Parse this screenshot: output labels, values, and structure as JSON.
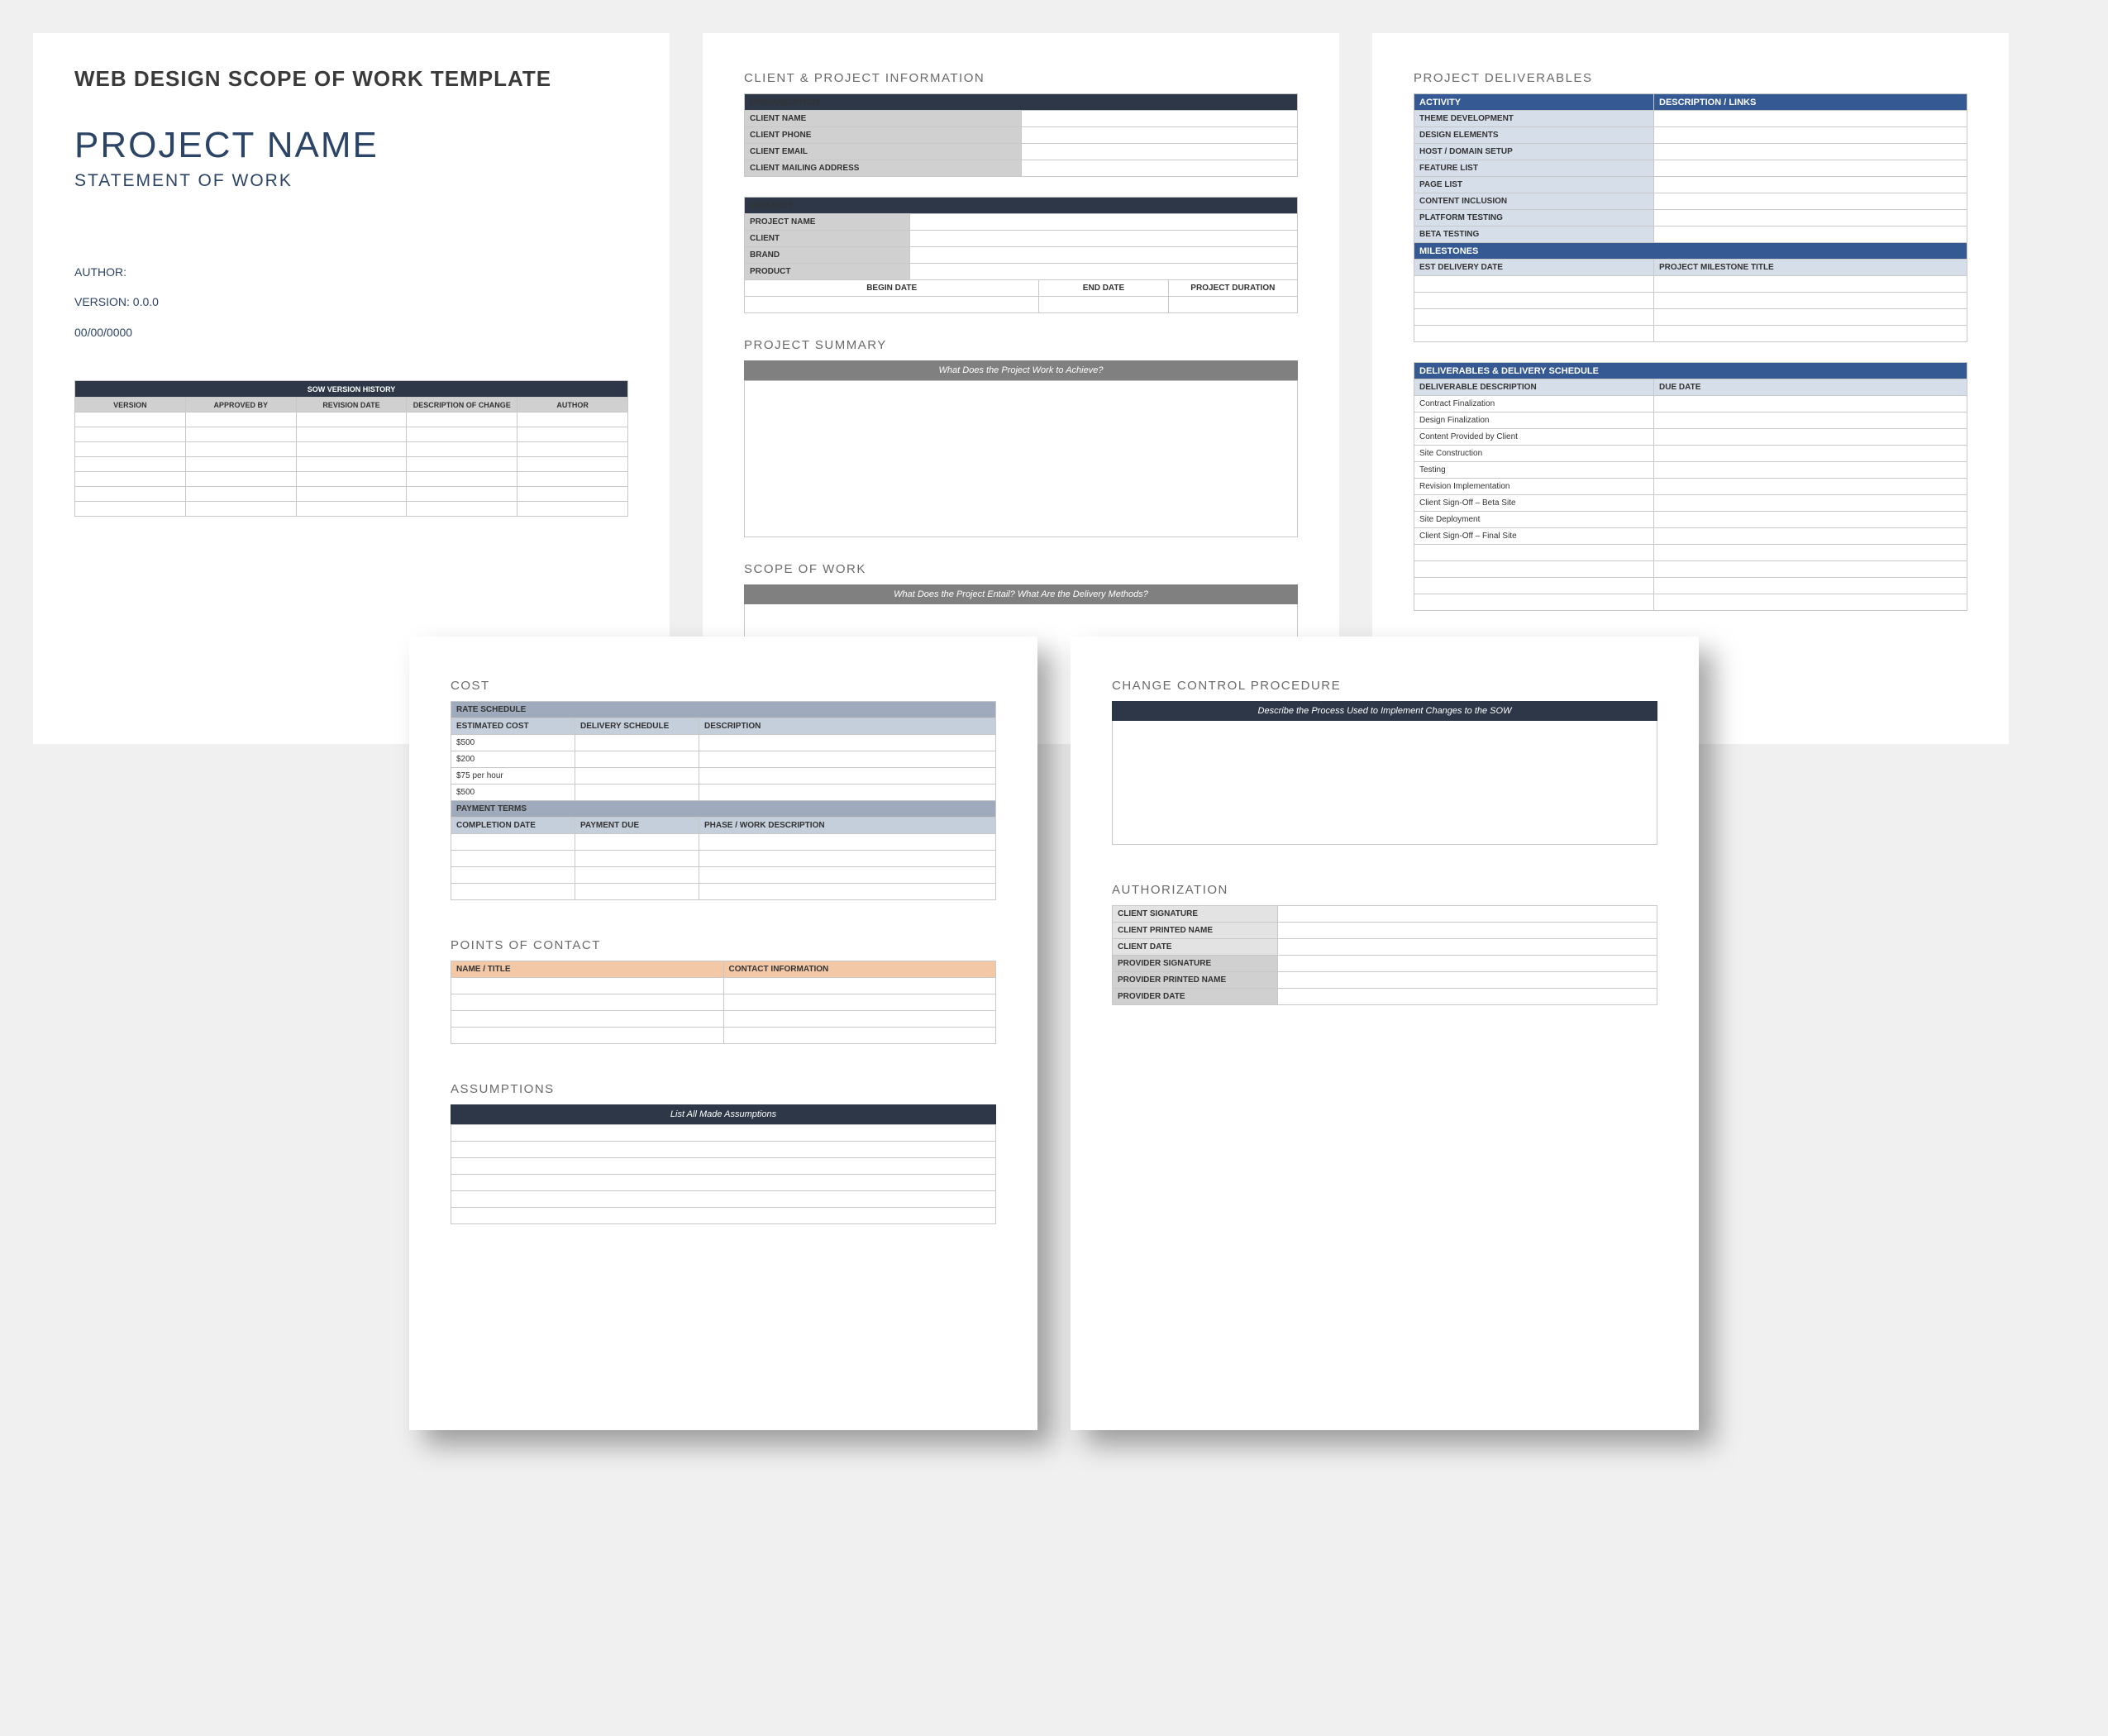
{
  "page1": {
    "template_title": "WEB DESIGN SCOPE OF WORK TEMPLATE",
    "project_name": "PROJECT NAME",
    "subtitle": "STATEMENT OF WORK",
    "author_label": "AUTHOR:",
    "version_label": "VERSION: 0.0.0",
    "date": "00/00/0000",
    "history": {
      "title": "SOW VERSION HISTORY",
      "cols": [
        "VERSION",
        "APPROVED BY",
        "REVISION DATE",
        "DESCRIPTION OF CHANGE",
        "AUTHOR"
      ]
    }
  },
  "page2": {
    "client_project_info": "CLIENT & PROJECT INFORMATION",
    "organization_hdr": "ORGANIZATION",
    "org_rows": [
      "CLIENT NAME",
      "CLIENT  PHONE",
      "CLIENT EMAIL",
      "CLIENT MAILING ADDRESS"
    ],
    "project_hdr": "PROJECT",
    "proj_rows": [
      "PROJECT NAME",
      "CLIENT",
      "BRAND",
      "PRODUCT"
    ],
    "proj_dates": [
      "BEGIN DATE",
      "END DATE",
      "PROJECT DURATION"
    ],
    "summary_title": "PROJECT SUMMARY",
    "summary_prompt": "What Does the Project Work to Achieve?",
    "scope_title": "SCOPE OF WORK",
    "scope_prompt": "What Does the Project Entail? What Are the Delivery Methods?"
  },
  "page3": {
    "deliverables_title": "PROJECT DELIVERABLES",
    "activity_hdr": [
      "ACTIVITY",
      "DESCRIPTION / LINKS"
    ],
    "activities": [
      "THEME DEVELOPMENT",
      "DESIGN ELEMENTS",
      "HOST / DOMAIN SETUP",
      "FEATURE LIST",
      "PAGE LIST",
      "CONTENT INCLUSION",
      "PLATFORM TESTING",
      "BETA TESTING"
    ],
    "milestones_hdr": "MILESTONES",
    "milestones_cols": [
      "EST DELIVERY DATE",
      "PROJECT MILESTONE TITLE"
    ],
    "schedule_hdr": "DELIVERABLES & DELIVERY SCHEDULE",
    "schedule_cols": [
      "DELIVERABLE DESCRIPTION",
      "DUE DATE"
    ],
    "schedule_rows": [
      "Contract Finalization",
      "Design Finalization",
      "Content Provided by Client",
      "Site Construction",
      "Testing",
      "Revision Implementation",
      "Client Sign-Off – Beta Site",
      "Site Deployment",
      "Client Sign-Off – Final Site"
    ]
  },
  "page4": {
    "cost_title": "COST",
    "rate_schedule_hdr": "RATE SCHEDULE",
    "rate_cols": [
      "ESTIMATED COST",
      "DELIVERY SCHEDULE",
      "DESCRIPTION"
    ],
    "rate_rows": [
      "$500",
      "$200",
      "$75 per hour",
      "$500"
    ],
    "payment_terms_hdr": "PAYMENT TERMS",
    "payment_cols": [
      "COMPLETION DATE",
      "PAYMENT DUE",
      "PHASE / WORK DESCRIPTION"
    ],
    "poc_title": "POINTS OF CONTACT",
    "poc_cols": [
      "NAME / TITLE",
      "CONTACT INFORMATION"
    ],
    "assumptions_title": "ASSUMPTIONS",
    "assumptions_prompt": "List All Made Assumptions"
  },
  "page5": {
    "ccp_title": "CHANGE CONTROL PROCEDURE",
    "ccp_prompt": "Describe the Process Used to Implement Changes to the SOW",
    "auth_title": "AUTHORIZATION",
    "auth_rows_client": [
      "CLIENT SIGNATURE",
      "CLIENT PRINTED NAME",
      "CLIENT DATE"
    ],
    "auth_rows_provider": [
      "PROVIDER SIGNATURE",
      "PROVIDER PRINTED NAME",
      "PROVIDER DATE"
    ]
  }
}
